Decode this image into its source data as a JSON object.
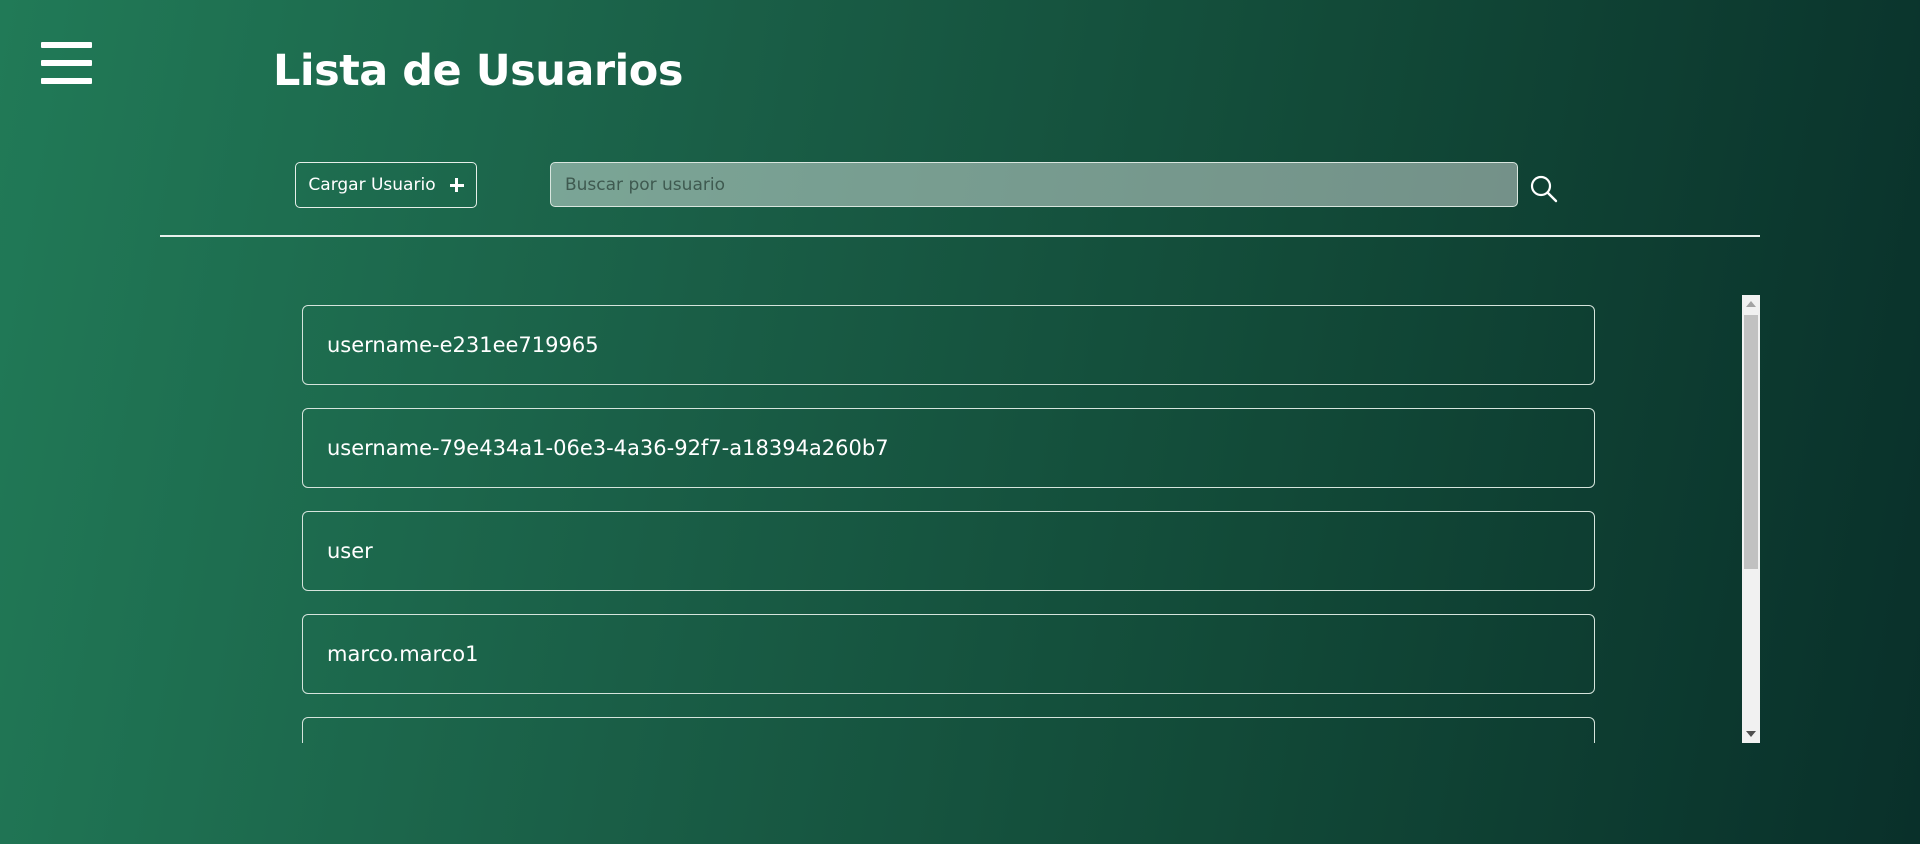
{
  "header": {
    "menu_icon": "hamburger-menu-icon",
    "title": "Lista de Usuarios"
  },
  "toolbar": {
    "load_button_label": "Cargar Usuario",
    "load_button_icon": "plus-icon",
    "search_placeholder": "Buscar por usuario",
    "search_value": "",
    "search_icon": "search-icon"
  },
  "users": [
    {
      "username": "username-e231ee719965"
    },
    {
      "username": "username-79e434a1-06e3-4a36-92f7-a18394a260b7"
    },
    {
      "username": "user"
    },
    {
      "username": "marco.marco1"
    },
    {
      "username": ""
    }
  ],
  "colors": {
    "gradient_start": "#217a57",
    "gradient_end": "#09302a",
    "text": "#ffffff",
    "border": "#d5e4dc"
  }
}
